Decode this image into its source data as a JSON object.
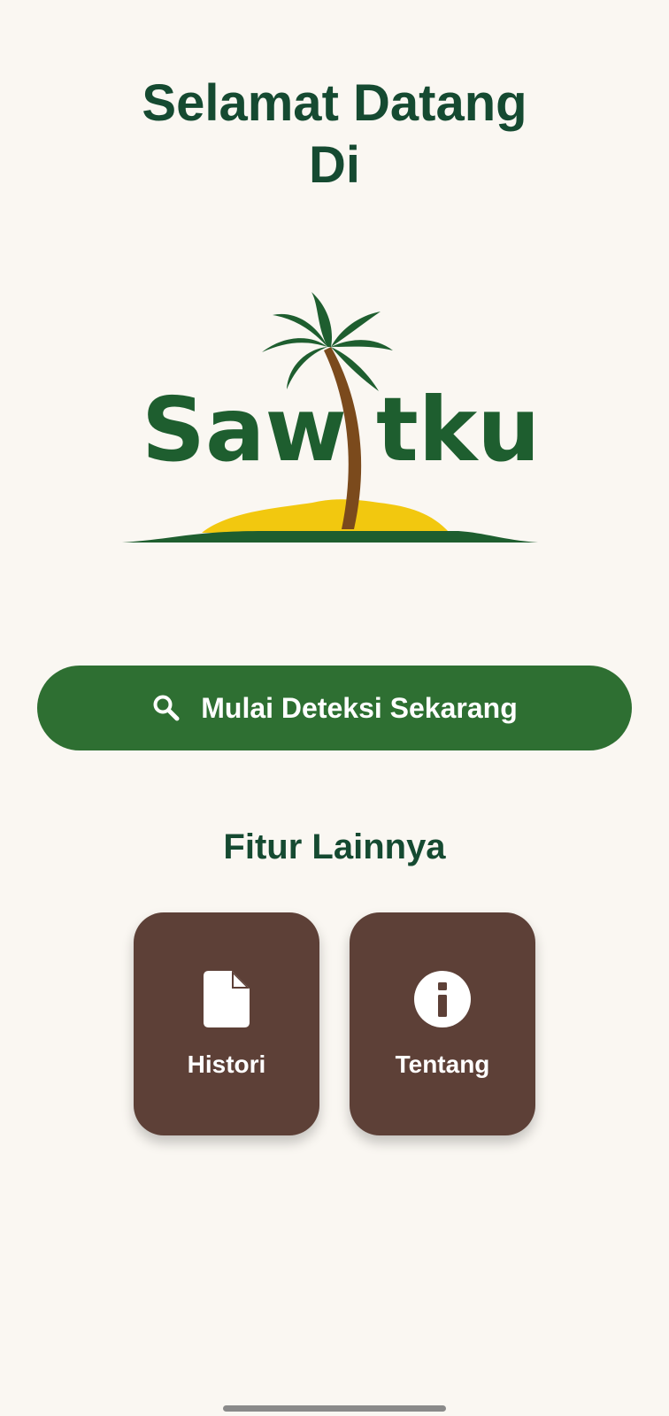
{
  "header": {
    "title_line1": "Selamat Datang",
    "title_line2": "Di"
  },
  "logo": {
    "text_before": "Saw",
    "text_after": "tku",
    "color": "#1e5e2f",
    "trunk_color": "#7b4a1c",
    "sand_color": "#f2c80f"
  },
  "main": {
    "detect_button_label": "Mulai Deteksi Sekarang",
    "detect_button_icon": "search-icon",
    "section_title": "Fitur Lainnya",
    "features": [
      {
        "label": "Histori",
        "icon": "document-icon"
      },
      {
        "label": "Tentang",
        "icon": "info-icon"
      }
    ]
  },
  "colors": {
    "background": "#faf7f2",
    "primary_green": "#2e6f32",
    "heading_green": "#154a31",
    "card_brown": "#5d4037"
  }
}
